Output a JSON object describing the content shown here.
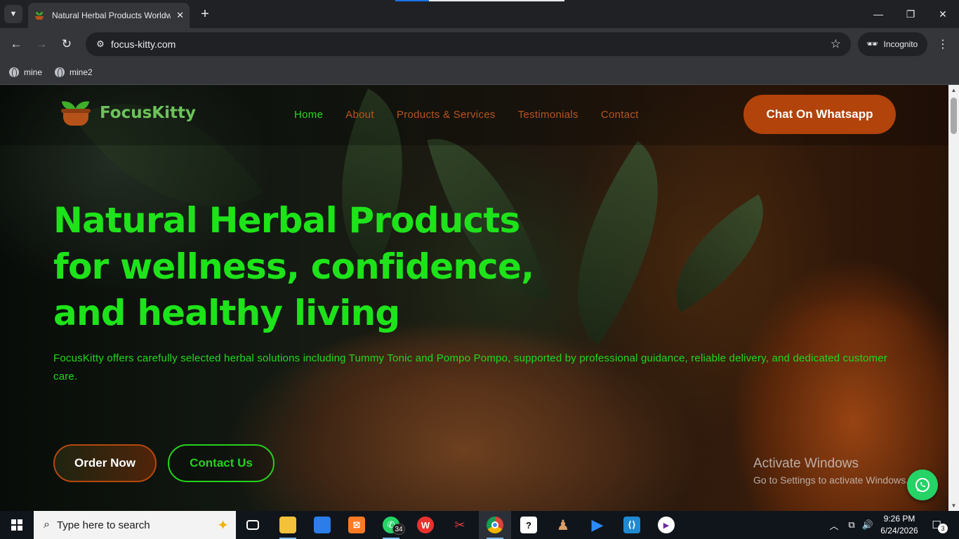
{
  "browser": {
    "tab": {
      "title": "Natural Herbal Products Worldwide",
      "close": "✕"
    },
    "new_tab": "+",
    "address": {
      "url": "focus-kitty.com"
    },
    "incognito_label": "Incognito",
    "bookmarks": [
      {
        "label": "mine"
      },
      {
        "label": "mine2"
      }
    ],
    "window_controls": {
      "minimize": "—",
      "restore": "❐",
      "close": "✕"
    }
  },
  "site": {
    "logo_text": "FocusKitty",
    "nav": [
      {
        "label": "Home",
        "active": true
      },
      {
        "label": "About",
        "active": false
      },
      {
        "label": "Products & Services",
        "active": false
      },
      {
        "label": "Testimonials",
        "active": false
      },
      {
        "label": "Contact",
        "active": false
      }
    ],
    "cta_whatsapp": "Chat On Whatsapp",
    "hero": {
      "title_lines": [
        "Natural Herbal Products",
        "for wellness, confidence,",
        "and healthy living"
      ],
      "subtitle": "FocusKitty offers carefully selected herbal solutions including Tummy Tonic and Pompo Pompo, supported by professional guidance, reliable delivery, and dedicated customer care.",
      "primary_button": "Order Now",
      "secondary_button": "Contact Us"
    },
    "colors": {
      "accent_green": "#1ee31a",
      "accent_orange": "#b1430b",
      "whatsapp_green": "#25d366"
    }
  },
  "os": {
    "activation": {
      "title": "Activate Windows",
      "detail": "Go to Settings to activate Windows."
    },
    "taskbar": {
      "search_placeholder": "Type here to search",
      "whatsapp_badge": "34",
      "clock_time": "9:26 PM",
      "clock_date": "6/24/2026",
      "notification_count": "3"
    }
  }
}
